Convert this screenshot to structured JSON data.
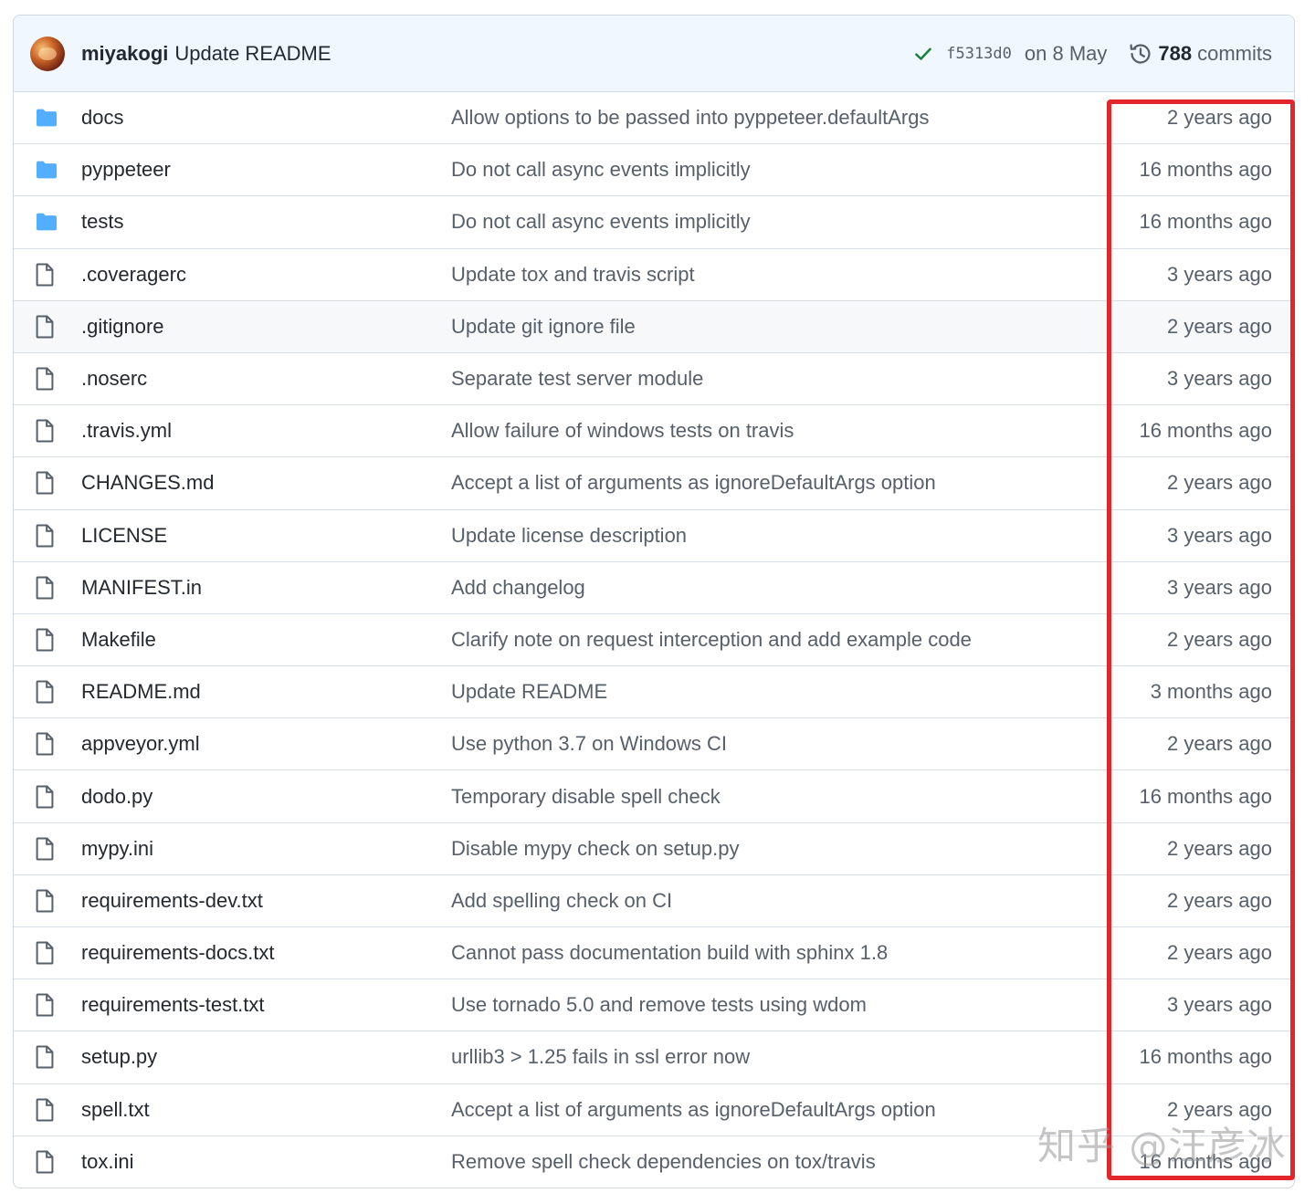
{
  "commit": {
    "author": "miyakogi",
    "message": "Update README",
    "sha": "f5313d0",
    "date": "on 8 May",
    "count": "788",
    "count_label": "commits"
  },
  "files": [
    {
      "type": "folder",
      "name": "docs",
      "message": "Allow options to be passed into pyppeteer.defaultArgs",
      "age": "2 years ago"
    },
    {
      "type": "folder",
      "name": "pyppeteer",
      "message": "Do not call async events implicitly",
      "age": "16 months ago"
    },
    {
      "type": "folder",
      "name": "tests",
      "message": "Do not call async events implicitly",
      "age": "16 months ago"
    },
    {
      "type": "file",
      "name": ".coveragerc",
      "message": "Update tox and travis script",
      "age": "3 years ago"
    },
    {
      "type": "file",
      "name": ".gitignore",
      "message": "Update git ignore file",
      "age": "2 years ago"
    },
    {
      "type": "file",
      "name": ".noserc",
      "message": "Separate test server module",
      "age": "3 years ago"
    },
    {
      "type": "file",
      "name": ".travis.yml",
      "message": "Allow failure of windows tests on travis",
      "age": "16 months ago"
    },
    {
      "type": "file",
      "name": "CHANGES.md",
      "message": "Accept a list of arguments as ignoreDefaultArgs option",
      "age": "2 years ago"
    },
    {
      "type": "file",
      "name": "LICENSE",
      "message": "Update license description",
      "age": "3 years ago"
    },
    {
      "type": "file",
      "name": "MANIFEST.in",
      "message": "Add changelog",
      "age": "3 years ago"
    },
    {
      "type": "file",
      "name": "Makefile",
      "message": "Clarify note on request interception and add example code",
      "age": "2 years ago"
    },
    {
      "type": "file",
      "name": "README.md",
      "message": "Update README",
      "age": "3 months ago"
    },
    {
      "type": "file",
      "name": "appveyor.yml",
      "message": "Use python 3.7 on Windows CI",
      "age": "2 years ago"
    },
    {
      "type": "file",
      "name": "dodo.py",
      "message": "Temporary disable spell check",
      "age": "16 months ago"
    },
    {
      "type": "file",
      "name": "mypy.ini",
      "message": "Disable mypy check on setup.py",
      "age": "2 years ago"
    },
    {
      "type": "file",
      "name": "requirements-dev.txt",
      "message": "Add spelling check on CI",
      "age": "2 years ago"
    },
    {
      "type": "file",
      "name": "requirements-docs.txt",
      "message": "Cannot pass documentation build with sphinx 1.8",
      "age": "2 years ago"
    },
    {
      "type": "file",
      "name": "requirements-test.txt",
      "message": "Use tornado 5.0 and remove tests using wdom",
      "age": "3 years ago"
    },
    {
      "type": "file",
      "name": "setup.py",
      "message": "urllib3 > 1.25 fails in ssl error now",
      "age": "16 months ago"
    },
    {
      "type": "file",
      "name": "spell.txt",
      "message": "Accept a list of arguments as ignoreDefaultArgs option",
      "age": "2 years ago"
    },
    {
      "type": "file",
      "name": "tox.ini",
      "message": "Remove spell check dependencies on tox/travis",
      "age": "16 months ago"
    }
  ],
  "hover_index": 4,
  "watermark": "知乎 @汪彦冰",
  "colors": {
    "folder": "#54aeff",
    "file_icon": "#57606a",
    "check": "#1a7f37",
    "header_bg": "#f0f7ff",
    "highlight": "#e3262b"
  },
  "icons": {
    "folder": "folder-icon",
    "file": "file-icon",
    "check": "check-icon",
    "history": "history-icon"
  }
}
